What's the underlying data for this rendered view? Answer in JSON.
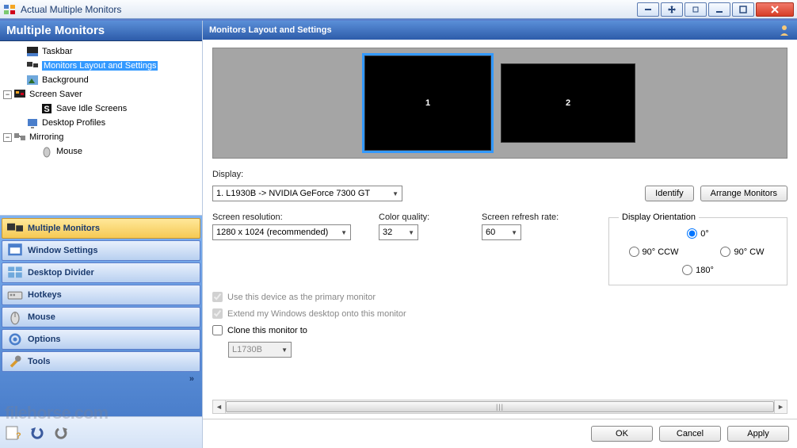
{
  "titlebar": {
    "title": "Actual Multiple Monitors"
  },
  "sidebar": {
    "header": "Multiple Monitors",
    "tree": {
      "taskbar": "Taskbar",
      "monitors_layout": "Monitors Layout and Settings",
      "background": "Background",
      "screen_saver": "Screen Saver",
      "save_idle": "Save Idle Screens",
      "desktop_profiles": "Desktop Profiles",
      "mirroring": "Mirroring",
      "mouse": "Mouse"
    },
    "nav": {
      "multiple_monitors": "Multiple Monitors",
      "window_settings": "Window Settings",
      "desktop_divider": "Desktop Divider",
      "hotkeys": "Hotkeys",
      "mouse": "Mouse",
      "options": "Options",
      "tools": "Tools"
    }
  },
  "content": {
    "header": "Monitors Layout and Settings",
    "monitor1": "1",
    "monitor2": "2",
    "display_label": "Display:",
    "display_value": "1. L1930B -> NVIDIA GeForce 7300 GT",
    "identify": "Identify",
    "arrange": "Arrange Monitors",
    "res_label": "Screen resolution:",
    "res_value": "1280 x 1024 (recommended)",
    "color_label": "Color quality:",
    "color_value": "32",
    "refresh_label": "Screen refresh rate:",
    "refresh_value": "60",
    "orient_label": "Display Orientation",
    "orient_0": "0°",
    "orient_90ccw": "90° CCW",
    "orient_90cw": "90° CW",
    "orient_180": "180°",
    "primary": "Use this device as the primary monitor",
    "extend": "Extend my Windows desktop onto this monitor",
    "clone": "Clone this monitor to",
    "clone_target": "L1730B"
  },
  "footer": {
    "ok": "OK",
    "cancel": "Cancel",
    "apply": "Apply"
  },
  "watermark": "filehorse.com"
}
